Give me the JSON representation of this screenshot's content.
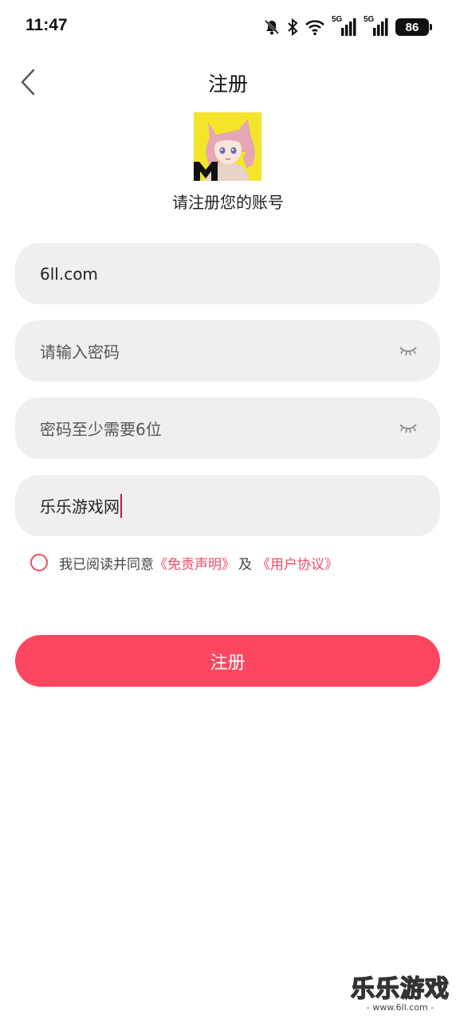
{
  "status_bar": {
    "time": "11:47",
    "network_1": "5G",
    "network_2": "5G",
    "battery": "86"
  },
  "header": {
    "title": "注册",
    "back_icon": "chevron-left-icon"
  },
  "logo": {
    "icon": "anime-cat-girl-avatar",
    "bg_color": "#f4e52a"
  },
  "subtitle": "请注册您的账号",
  "form": {
    "username_value": "6ll.com",
    "password_placeholder": "请输入密码",
    "confirm_placeholder": "密码至少需要6位",
    "nickname_value": "乐乐游戏网"
  },
  "agreement": {
    "prefix": "我已阅读并同意",
    "disclaimer_link": "《免责声明》",
    "conjunction": "及",
    "user_agreement_link": "《用户协议》"
  },
  "submit_label": "注册",
  "watermark": {
    "title": "乐乐游戏",
    "url": "- www.6ll.com -"
  },
  "colors": {
    "accent": "#ff4660",
    "link": "#ef4a64",
    "field_bg": "#efefef"
  }
}
